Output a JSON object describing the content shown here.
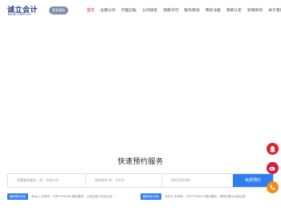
{
  "header": {
    "logo_cn": "诚立会计",
    "logo_en": "bcac.com.cn",
    "badge": "更多服务"
  },
  "nav": {
    "items": [
      "首页",
      "注册公司",
      "代理记账",
      "公司核名",
      "资质许可",
      "税务筹划",
      "商标注册",
      "高新认定",
      "财税资讯",
      "关于我们"
    ],
    "active_index": 0
  },
  "section": {
    "title": "快速预约服务"
  },
  "form": {
    "service_placeholder": "您需要的服务，如：注册公司",
    "name_placeholder": "您的称呼 如：马先生",
    "phone_placeholder": "您的手机号码",
    "submit_label": "免费预约"
  },
  "ticker": {
    "left_tag": "最新预约信息",
    "left_text": "李女士    手机号：138****6936    预约服务：公司注册    5分钟之前",
    "right_tag": "最新预约信息",
    "right_text": "马先生    手机号：135****8513    预约服务：资质办理    5分钟之前"
  },
  "floats": {
    "icons": [
      "qq-icon",
      "weibo-icon",
      "phone-icon"
    ]
  },
  "colors": {
    "brand": "#1f3c88",
    "nav_active": "#e02020",
    "primary": "#2f7ef0",
    "float_red": "#e11d2a",
    "float_orange": "#f28a17"
  }
}
